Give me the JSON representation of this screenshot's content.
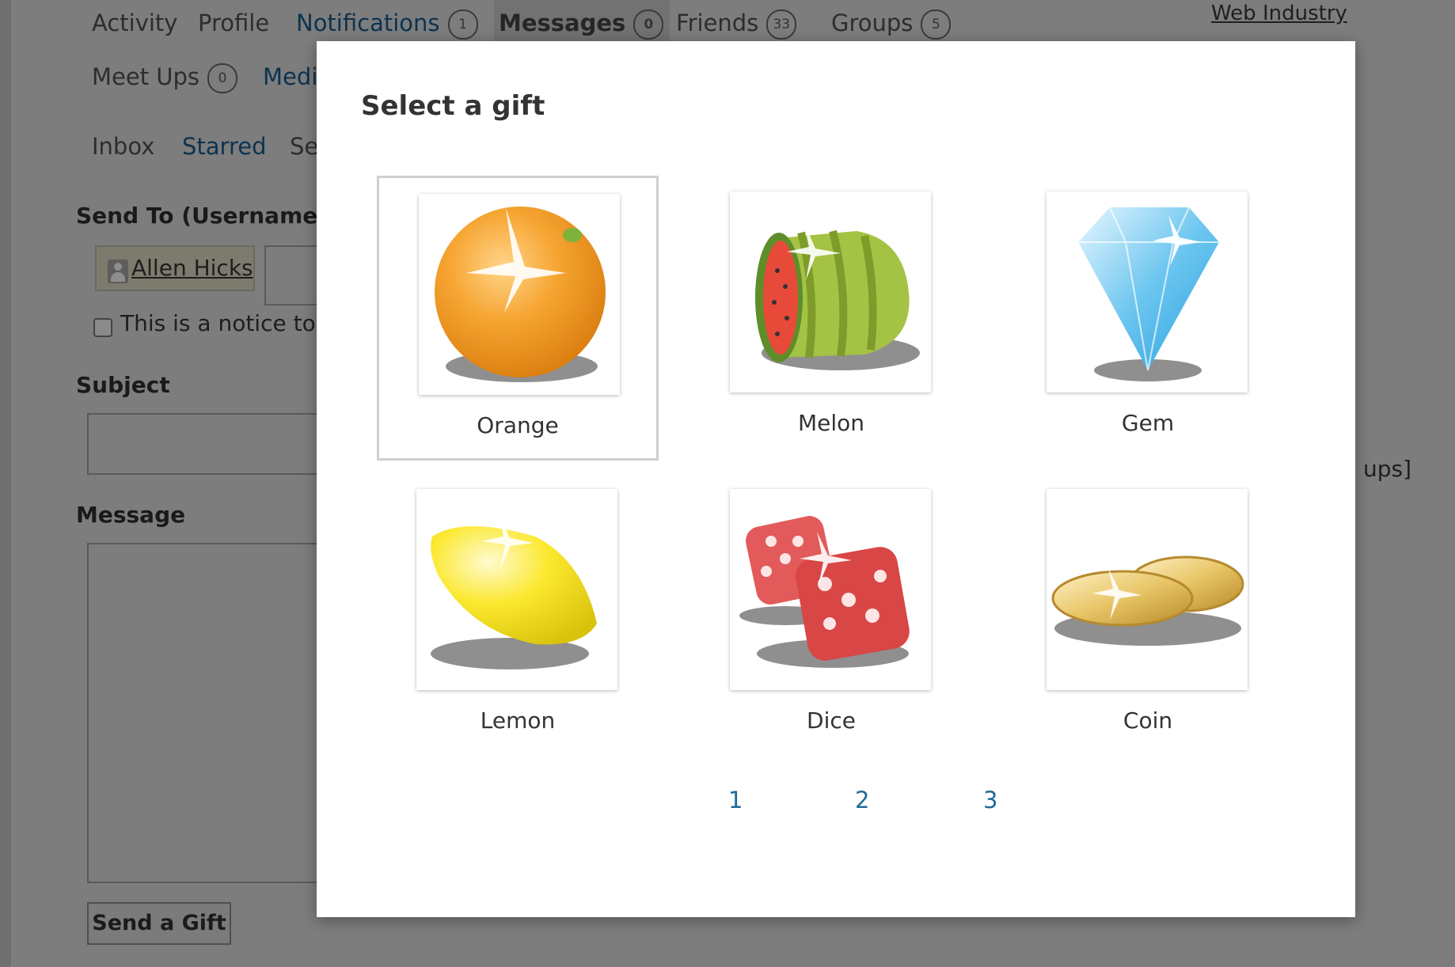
{
  "nav": {
    "tabs": [
      {
        "label": "Activity"
      },
      {
        "label": "Profile"
      },
      {
        "label": "Notifications",
        "count": "1"
      },
      {
        "label": "Messages",
        "count": "0"
      },
      {
        "label": "Friends",
        "count": "33"
      },
      {
        "label": "Groups",
        "count": "5"
      },
      {
        "label": "Meet Ups",
        "count": "0"
      },
      {
        "label": "Medi"
      }
    ],
    "external_link": "Web Industry"
  },
  "subnav": {
    "items": [
      "Inbox",
      "Starred",
      "Se"
    ]
  },
  "compose": {
    "send_to_label": "Send To (Username or",
    "recipient_name": "Allen Hicks",
    "notice_label": "This is a notice to all",
    "subject_label": "Subject",
    "message_label": "Message",
    "send_button": "Send a Gift",
    "right_fragment": "ups]"
  },
  "modal": {
    "title": "Select a gift",
    "selected": "Orange",
    "gifts": [
      {
        "name": "Orange",
        "icon": "orange-icon"
      },
      {
        "name": "Melon",
        "icon": "melon-icon"
      },
      {
        "name": "Gem",
        "icon": "gem-icon"
      },
      {
        "name": "Lemon",
        "icon": "lemon-icon"
      },
      {
        "name": "Dice",
        "icon": "dice-icon"
      },
      {
        "name": "Coin",
        "icon": "coin-icon"
      }
    ],
    "pages": [
      "1",
      "2",
      "3"
    ]
  },
  "colors": {
    "overlay": "#7d7d7d",
    "link": "#1e6b99",
    "modal_bg": "#ffffff"
  }
}
